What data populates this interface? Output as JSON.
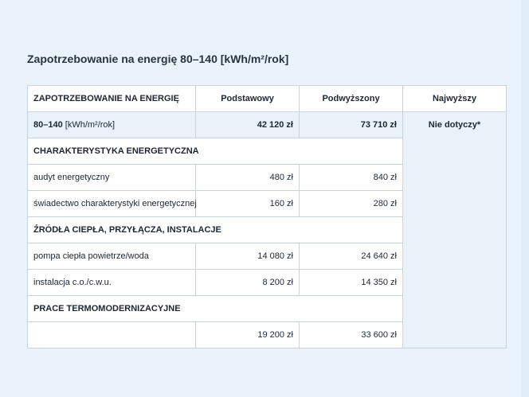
{
  "title": "Zapotrzebowanie na energię 80–140 [kWh/m²/rok]",
  "table": {
    "headers": [
      "ZAPOTRZEBOWANIE NA ENERGIĘ",
      "Podstawowy",
      "Podwyższony",
      "Najwyższy"
    ],
    "summary": {
      "label_bold": "80–140",
      "label_rest": " [kWh/m²/rok]",
      "basic": "42 120 zł",
      "raised": "73 710 zł",
      "highest": "Nie dotyczy*"
    },
    "sections": [
      {
        "title": "CHARAKTERYSTYKA ENERGETYCZNA",
        "rows": [
          {
            "label": "audyt energetyczny",
            "basic": "480 zł",
            "raised": "840 zł"
          },
          {
            "label": "świadectwo charakterystyki energetycznej",
            "basic": "160 zł",
            "raised": "280 zł"
          }
        ]
      },
      {
        "title": "ŹRÓDŁA CIEPŁA, PRZYŁĄCZA, INSTALACJE",
        "rows": [
          {
            "label": "pompa ciepła powietrze/woda",
            "basic": "14 080 zł",
            "raised": "24 640 zł"
          },
          {
            "label": "instalacja c.o./c.w.u.",
            "basic": "8 200 zł",
            "raised": "14 350 zł"
          }
        ]
      },
      {
        "title": "PRACE TERMOMODERNIZACYJNE",
        "rows": [
          {
            "label": "",
            "basic": "19 200 zł",
            "raised": "33 600 zł"
          }
        ]
      }
    ]
  }
}
